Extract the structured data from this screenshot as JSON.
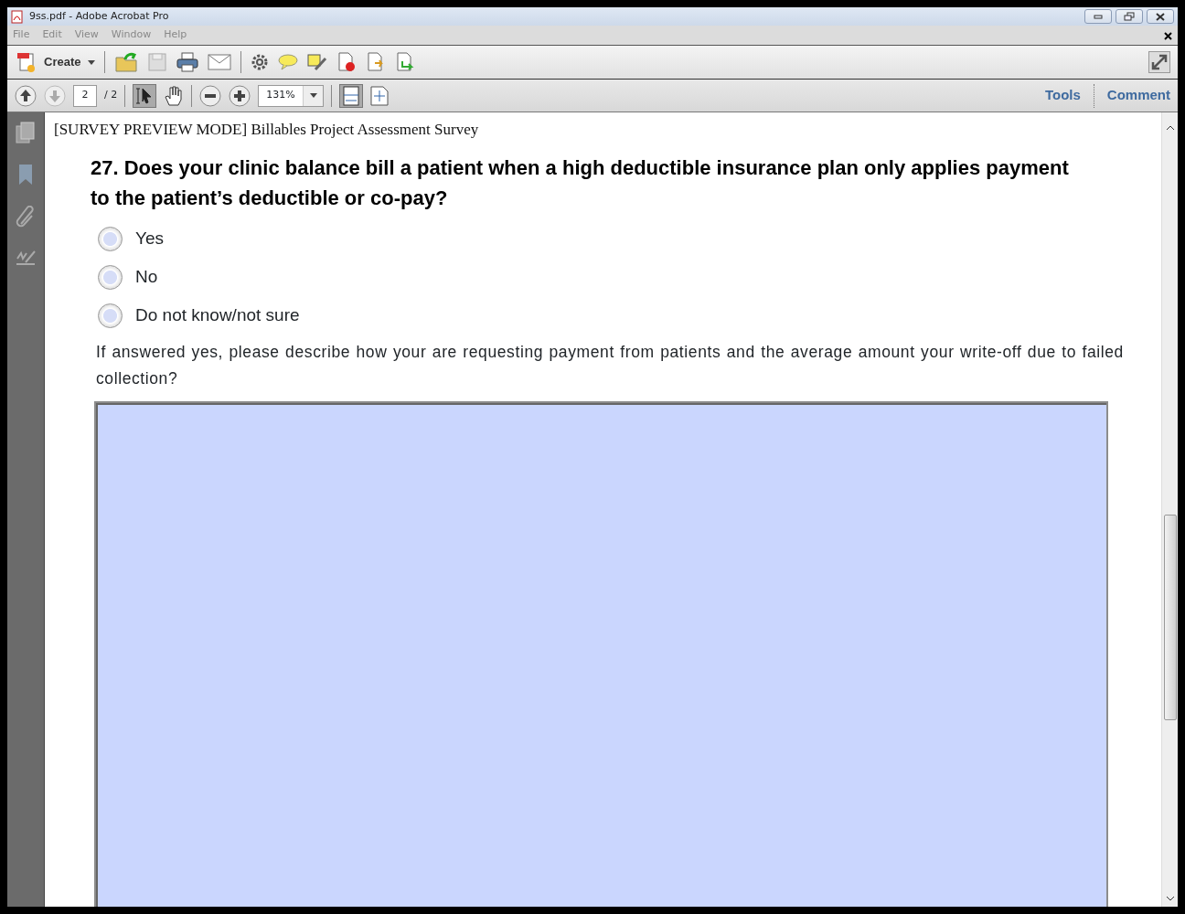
{
  "window": {
    "title": "9ss.pdf - Adobe Acrobat Pro"
  },
  "menu": [
    "File",
    "Edit",
    "View",
    "Window",
    "Help"
  ],
  "toolbar": {
    "create_label": "Create"
  },
  "nav_toolbar": {
    "page": "2",
    "page_total": "/ 2",
    "zoom": "131%",
    "links": [
      "Tools",
      "Comment"
    ]
  },
  "document": {
    "header": "[SURVEY PREVIEW MODE] Billables Project Assessment Survey",
    "question": "27. Does your clinic balance bill a patient when a high deductible insurance plan only applies payment to the patient’s deductible or co-pay?",
    "options": [
      {
        "label": "Yes",
        "selected": false
      },
      {
        "label": "No",
        "selected": false
      },
      {
        "label": "Do not know/not sure",
        "selected": false
      }
    ],
    "prompt": "If answered yes, please describe how your are requesting payment from patients and the average amount your write-off due to failed collection?"
  }
}
